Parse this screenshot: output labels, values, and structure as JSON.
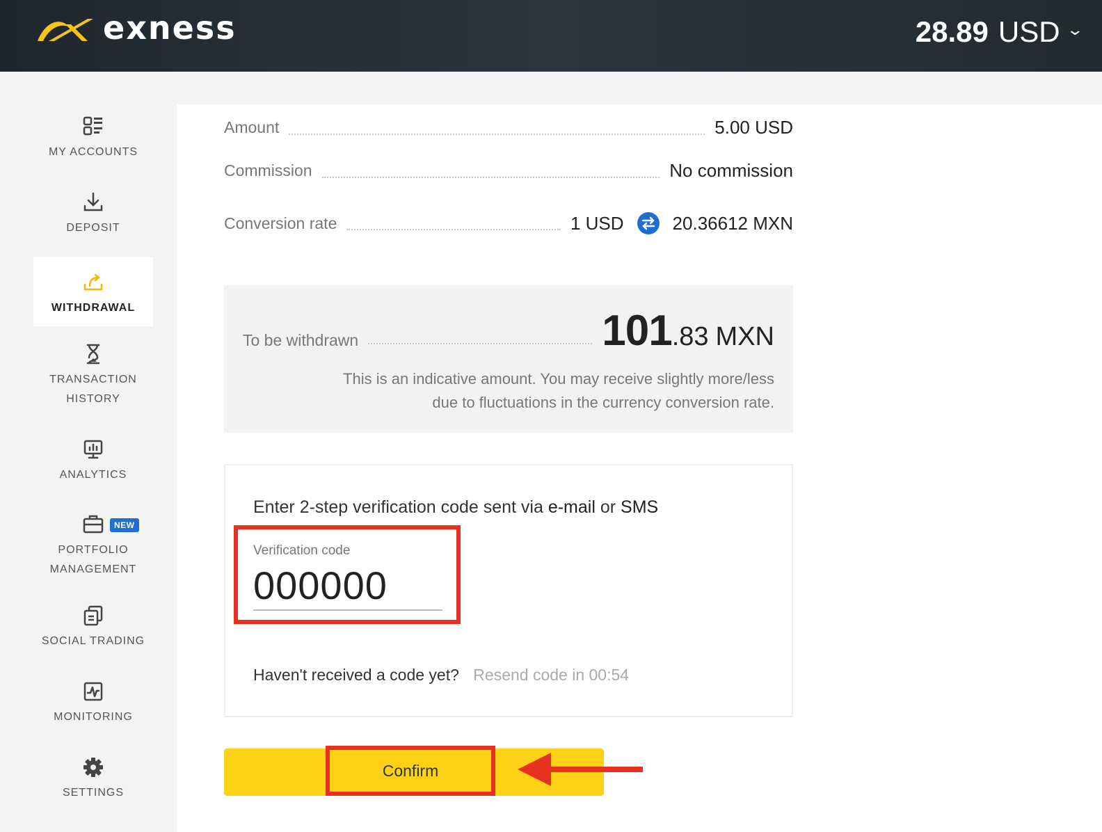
{
  "header": {
    "logo_text": "exness",
    "balance_amount": "28.89",
    "balance_currency": "USD"
  },
  "sidebar": {
    "items": [
      {
        "label": "MY ACCOUNTS",
        "icon": "grid-icon"
      },
      {
        "label": "DEPOSIT",
        "icon": "download-icon"
      },
      {
        "label": "WITHDRAWAL",
        "icon": "upload-icon",
        "active": true
      },
      {
        "label": "TRANSACTION HISTORY",
        "icon": "hourglass-icon"
      },
      {
        "label": "ANALYTICS",
        "icon": "analytics-icon"
      },
      {
        "label": "PORTFOLIO MANAGEMENT",
        "icon": "briefcase-icon",
        "badge": "NEW"
      },
      {
        "label": "SOCIAL TRADING",
        "icon": "copy-icon"
      },
      {
        "label": "MONITORING",
        "icon": "monitoring-icon"
      },
      {
        "label": "SETTINGS",
        "icon": "gear-icon"
      }
    ]
  },
  "summary": {
    "amount_label": "Amount",
    "amount_value": "5.00 USD",
    "commission_label": "Commission",
    "commission_value": "No commission",
    "rate_label": "Conversion rate",
    "rate_from": "1 USD",
    "rate_to": "20.36612 MXN"
  },
  "withdraw": {
    "label": "To be withdrawn",
    "amount_int": "101",
    "amount_dec": ".83",
    "currency": "MXN",
    "note_line1": "This is an indicative amount. You may receive slightly more/less",
    "note_line2": "due to fluctuations in the currency conversion rate."
  },
  "verification": {
    "title_pre": "Enter 2-step verification code sent via ",
    "title_email": "e-mail",
    "title_mid": " or ",
    "title_sms": "SMS",
    "field_label": "Verification code",
    "field_value": "000000",
    "resend_question": "Haven't received a code yet?",
    "resend_timer": "Resend code in 00:54"
  },
  "actions": {
    "confirm_label": "Confirm"
  },
  "colors": {
    "accent_yellow": "#fdd115",
    "highlight_red": "#e8321f",
    "badge_blue": "#1e6fd0"
  }
}
